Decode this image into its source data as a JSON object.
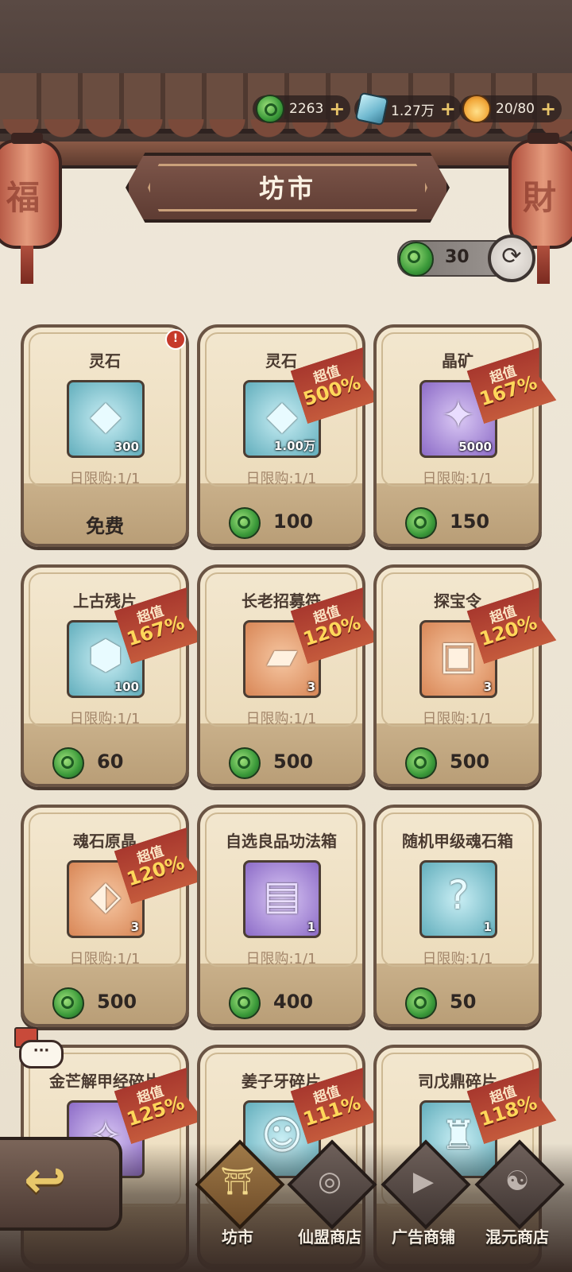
{
  "currencies": [
    {
      "name": "jade-icon",
      "value": "2263"
    },
    {
      "name": "spirit-stone-icon",
      "value": "1.27万"
    },
    {
      "name": "stamina-flame-icon",
      "value": "20/80"
    }
  ],
  "lantern_glyphs": [
    "福",
    "財"
  ],
  "title": "坊市",
  "refresh": {
    "cost": "30",
    "icon": "refresh-icon"
  },
  "cards": [
    {
      "title": "灵石",
      "qty": "300",
      "limit": "日限购:1/1",
      "price": "免费",
      "free": true,
      "alert": "!",
      "icon": "spirit-stone-icon",
      "bg": "teal"
    },
    {
      "title": "灵石",
      "qty": "1.00万",
      "limit": "日限购:1/1",
      "price": "100",
      "tag1": "超值",
      "tag2": "500%",
      "icon": "spirit-stone-icon",
      "bg": "teal"
    },
    {
      "title": "晶矿",
      "qty": "5000",
      "limit": "日限购:1/1",
      "price": "150",
      "tag1": "超值",
      "tag2": "167%",
      "icon": "crystal-ore-icon",
      "bg": "purple"
    },
    {
      "title": "上古残片",
      "qty": "100",
      "limit": "日限购:1/1",
      "price": "60",
      "tag1": "超值",
      "tag2": "167%",
      "icon": "ancient-fragment-icon",
      "bg": "teal"
    },
    {
      "title": "长老招募符",
      "qty": "3",
      "limit": "日限购:1/1",
      "price": "500",
      "tag1": "超值",
      "tag2": "120%",
      "icon": "recruit-talisman-icon",
      "bg": "orange"
    },
    {
      "title": "探宝令",
      "qty": "3",
      "limit": "日限购:1/1",
      "price": "500",
      "tag1": "超值",
      "tag2": "120%",
      "icon": "treasure-token-icon",
      "bg": "orange"
    },
    {
      "title": "魂石原晶",
      "qty": "3",
      "limit": "日限购:1/1",
      "price": "500",
      "tag1": "超值",
      "tag2": "120%",
      "icon": "soul-crystal-icon",
      "bg": "orange"
    },
    {
      "title": "自选良品功法箱",
      "qty": "1",
      "limit": "日限购:1/1",
      "price": "400",
      "icon": "skill-chest-icon",
      "bg": "purple"
    },
    {
      "title": "随机甲级魂石箱",
      "qty": "1",
      "limit": "日限购:1/1",
      "price": "50",
      "icon": "mystery-chest-icon",
      "bg": "teal"
    },
    {
      "title": "金芒解甲经碎片",
      "tag1": "超值",
      "tag2": "125%",
      "icon": "scroll-fragment-icon",
      "bg": "purple"
    },
    {
      "title": "姜子牙碎片",
      "tag1": "超值",
      "tag2": "111%",
      "icon": "hero-fragment-icon",
      "bg": "teal"
    },
    {
      "title": "司戊鼎碎片",
      "tag1": "超值",
      "tag2": "118%",
      "icon": "cauldron-fragment-icon",
      "bg": "teal"
    }
  ],
  "chat": {
    "text": "···"
  },
  "nav": [
    {
      "label": "坊市",
      "active": true,
      "icon": "market-icon"
    },
    {
      "label": "仙盟商店",
      "active": false,
      "icon": "alliance-shop-icon"
    },
    {
      "label": "广告商铺",
      "active": false,
      "icon": "ad-shop-icon"
    },
    {
      "label": "混元商店",
      "active": false,
      "icon": "hunyuan-shop-icon"
    }
  ],
  "back": {
    "icon": "back-arrow-icon",
    "glyph": "↩"
  }
}
